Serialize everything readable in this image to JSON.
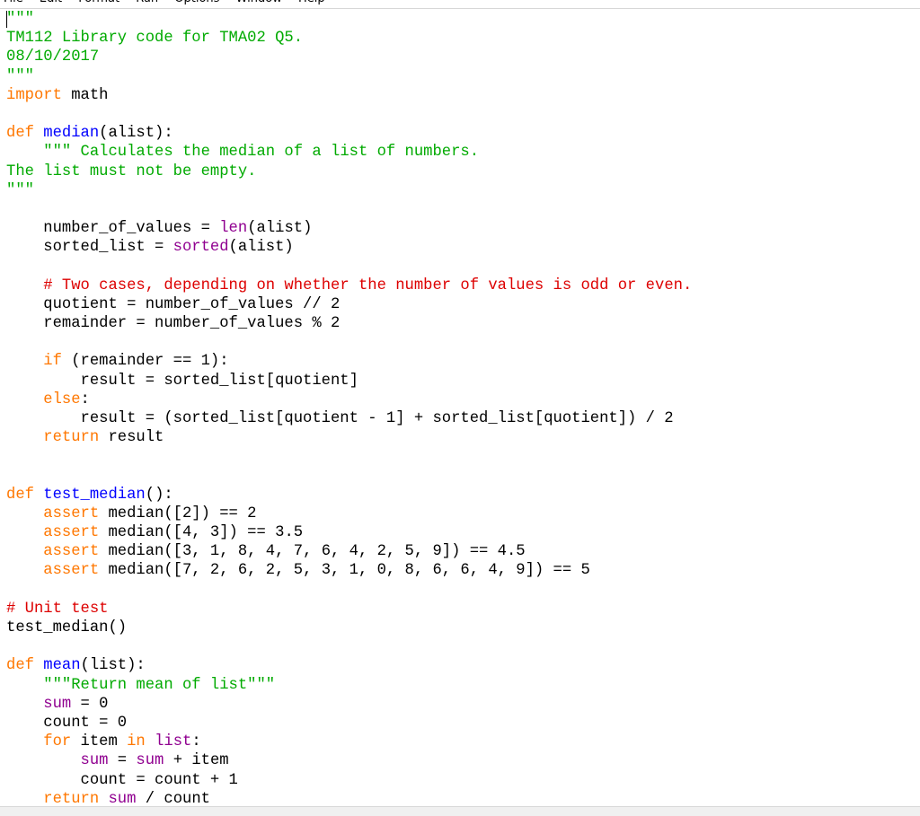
{
  "menu": {
    "items": [
      "File",
      "Edit",
      "Format",
      "Run",
      "Options",
      "Window",
      "Help"
    ]
  },
  "colors": {
    "keyword": "#ff7700",
    "definition": "#0000ff",
    "string": "#00aa00",
    "comment": "#dd0000",
    "builtin": "#900090",
    "text": "#000000",
    "background": "#ffffff"
  },
  "editor": {
    "lines": [
      [
        [
          "str",
          "\"\"\""
        ]
      ],
      [
        [
          "str",
          "TM112 Library code for TMA02 Q5."
        ]
      ],
      [
        [
          "str",
          "08/10/2017"
        ]
      ],
      [
        [
          "str",
          "\"\"\""
        ]
      ],
      [
        [
          "kw",
          "import"
        ],
        [
          "op",
          " math"
        ]
      ],
      [],
      [
        [
          "kw",
          "def"
        ],
        [
          "op",
          " "
        ],
        [
          "def",
          "median"
        ],
        [
          "op",
          "(alist):"
        ]
      ],
      [
        [
          "op",
          "    "
        ],
        [
          "str",
          "\"\"\" Calculates the median of a list of numbers."
        ]
      ],
      [
        [
          "str",
          "The list must not be empty."
        ]
      ],
      [
        [
          "str",
          "\"\"\""
        ]
      ],
      [],
      [
        [
          "op",
          "    number_of_values = "
        ],
        [
          "bi",
          "len"
        ],
        [
          "op",
          "(alist)"
        ]
      ],
      [
        [
          "op",
          "    sorted_list = "
        ],
        [
          "bi",
          "sorted"
        ],
        [
          "op",
          "(alist)"
        ]
      ],
      [],
      [
        [
          "op",
          "    "
        ],
        [
          "com",
          "# Two cases, depending on whether the number of values is odd or even."
        ]
      ],
      [
        [
          "op",
          "    quotient = number_of_values // 2"
        ]
      ],
      [
        [
          "op",
          "    remainder = number_of_values % 2"
        ]
      ],
      [],
      [
        [
          "op",
          "    "
        ],
        [
          "kw",
          "if"
        ],
        [
          "op",
          " (remainder == 1):"
        ]
      ],
      [
        [
          "op",
          "        result = sorted_list[quotient]"
        ]
      ],
      [
        [
          "op",
          "    "
        ],
        [
          "kw",
          "else"
        ],
        [
          "op",
          ":"
        ]
      ],
      [
        [
          "op",
          "        result = (sorted_list[quotient - 1] + sorted_list[quotient]) / 2"
        ]
      ],
      [
        [
          "op",
          "    "
        ],
        [
          "kw",
          "return"
        ],
        [
          "op",
          " result"
        ]
      ],
      [],
      [],
      [
        [
          "kw",
          "def"
        ],
        [
          "op",
          " "
        ],
        [
          "def",
          "test_median"
        ],
        [
          "op",
          "():"
        ]
      ],
      [
        [
          "op",
          "    "
        ],
        [
          "kw",
          "assert"
        ],
        [
          "op",
          " median([2]) == 2"
        ]
      ],
      [
        [
          "op",
          "    "
        ],
        [
          "kw",
          "assert"
        ],
        [
          "op",
          " median([4, 3]) == 3.5"
        ]
      ],
      [
        [
          "op",
          "    "
        ],
        [
          "kw",
          "assert"
        ],
        [
          "op",
          " median([3, 1, 8, 4, 7, 6, 4, 2, 5, 9]) == 4.5"
        ]
      ],
      [
        [
          "op",
          "    "
        ],
        [
          "kw",
          "assert"
        ],
        [
          "op",
          " median([7, 2, 6, 2, 5, 3, 1, 0, 8, 6, 6, 4, 9]) == 5"
        ]
      ],
      [],
      [
        [
          "com",
          "# Unit test"
        ]
      ],
      [
        [
          "op",
          "test_median()"
        ]
      ],
      [],
      [
        [
          "kw",
          "def"
        ],
        [
          "op",
          " "
        ],
        [
          "def",
          "mean"
        ],
        [
          "op",
          "(list):"
        ]
      ],
      [
        [
          "op",
          "    "
        ],
        [
          "str",
          "\"\"\"Return mean of list\"\"\""
        ]
      ],
      [
        [
          "op",
          "    "
        ],
        [
          "bi",
          "sum"
        ],
        [
          "op",
          " = 0"
        ]
      ],
      [
        [
          "op",
          "    count = 0"
        ]
      ],
      [
        [
          "op",
          "    "
        ],
        [
          "kw",
          "for"
        ],
        [
          "op",
          " item "
        ],
        [
          "kw",
          "in"
        ],
        [
          "op",
          " "
        ],
        [
          "bi",
          "list"
        ],
        [
          "op",
          ":"
        ]
      ],
      [
        [
          "op",
          "        "
        ],
        [
          "bi",
          "sum"
        ],
        [
          "op",
          " = "
        ],
        [
          "bi",
          "sum"
        ],
        [
          "op",
          " + item"
        ]
      ],
      [
        [
          "op",
          "        count = count + 1"
        ]
      ],
      [
        [
          "op",
          "    "
        ],
        [
          "kw",
          "return"
        ],
        [
          "op",
          " "
        ],
        [
          "bi",
          "sum"
        ],
        [
          "op",
          " / count"
        ]
      ]
    ]
  }
}
